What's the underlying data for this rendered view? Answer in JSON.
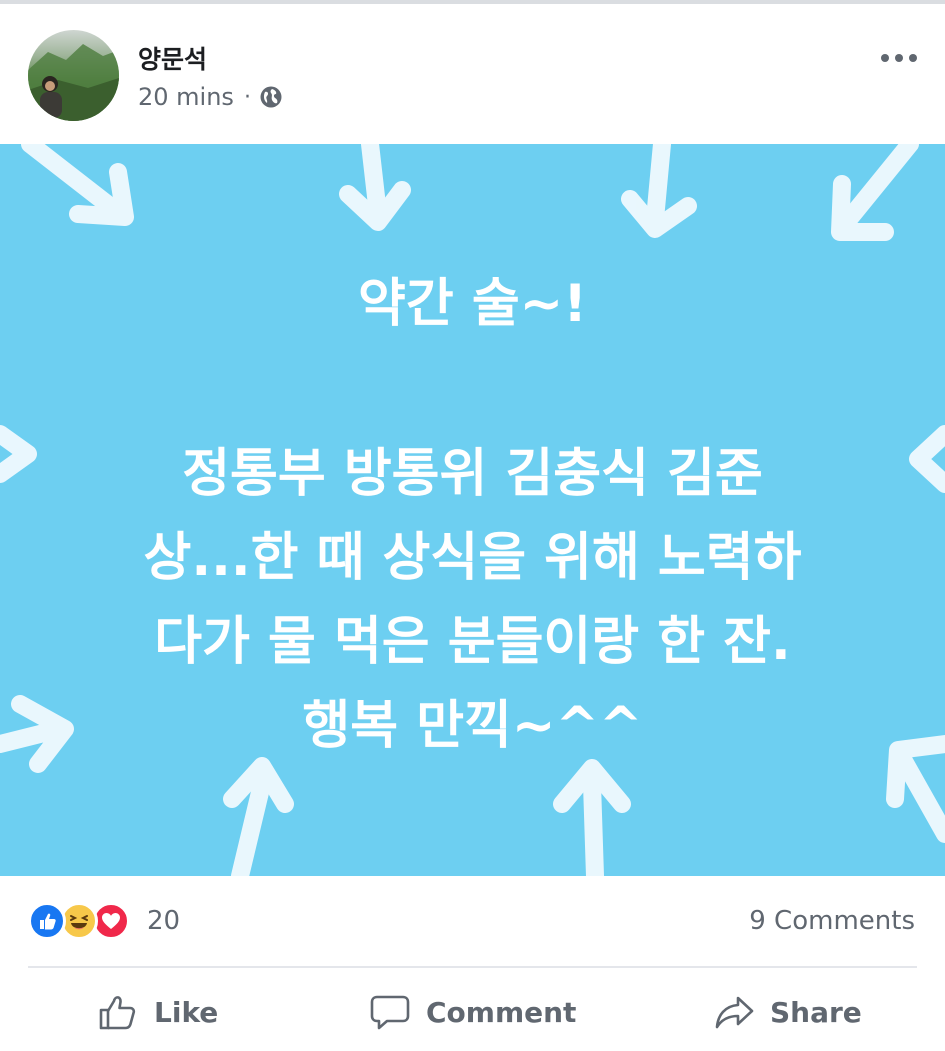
{
  "post": {
    "author": "양문석",
    "time": "20 mins",
    "separator": "·",
    "privacy_icon": "globe-icon",
    "more_icon": "more-horizontal-icon",
    "background_color": "#6dcff1",
    "text_color": "#ffffff",
    "text_line1": "약간 술~!",
    "text_body": [
      "정통부 방통위 김충식 김준",
      "상...한 때 상식을 위해 노력하",
      "다가 물 먹은 분들이랑 한 잔.",
      "행복 만끽~^^"
    ]
  },
  "reactions": {
    "icons": [
      "like-reaction-icon",
      "haha-reaction-icon",
      "love-reaction-icon"
    ],
    "count": "20",
    "comments": "9 Comments"
  },
  "actions": {
    "like": "Like",
    "comment": "Comment",
    "share": "Share"
  },
  "colors": {
    "like_blue": "#1877f2",
    "haha_yellow": "#f7c84a",
    "love_red": "#f0284a",
    "muted_text": "#606770"
  }
}
